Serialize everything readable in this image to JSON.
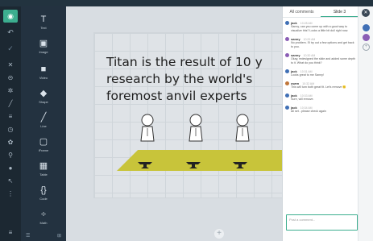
{
  "rail": {
    "items": [
      "visibility-icon",
      "undo-icon",
      "check-icon",
      "close-icon",
      "align-icon",
      "settings-icon",
      "brush-icon",
      "list-icon",
      "clock-icon",
      "color-icon",
      "pin-icon",
      "chat-icon",
      "pointer-icon",
      "more-icon",
      "menu-icon"
    ]
  },
  "tools": {
    "items": [
      {
        "label": "Text",
        "icon": "T"
      },
      {
        "label": "Image",
        "icon": "▣"
      },
      {
        "label": "Video",
        "icon": "■"
      },
      {
        "label": "Shape",
        "icon": "◆"
      },
      {
        "label": "Line",
        "icon": "╱"
      },
      {
        "label": "iFrame",
        "icon": "▢"
      },
      {
        "label": "Table",
        "icon": "▦"
      },
      {
        "label": "Code",
        "icon": "{}"
      },
      {
        "label": "Math",
        "icon": "÷"
      }
    ]
  },
  "slide": {
    "title": "Titan is the result of 10 y\nresearch by the world's\nforemost anvil experts"
  },
  "comments": {
    "tabs": [
      "All comments",
      "Slide 3"
    ],
    "thread": [
      {
        "user": "jack",
        "time": "10:28 AM",
        "text": "Sanny, can you come up with a good way to visualize this? Looks a little bit dull right now."
      },
      {
        "user": "sanny",
        "time": "10:29 AM",
        "text": "No problem. I'll try out a few options and get back to you."
      },
      {
        "user": "sanny",
        "time": "10:30 AM",
        "text": "Okay, redesigned the slide and added some depth to it. What do you think?"
      },
      {
        "user": "jack",
        "time": "10:31 AM",
        "text": "Looks great to me Sanny!"
      },
      {
        "user": "owen",
        "time": "10:32 AM",
        "text": "This will turn both great fit. Let's remove 🙂"
      },
      {
        "user": "jack",
        "time": "10:33 AM",
        "text": "Sure, will remove."
      },
      {
        "user": "jack",
        "time": "10:34 AM",
        "text": "All set - please check again"
      }
    ],
    "reply_placeholder": "Post a comment..."
  },
  "colors": {
    "accent": "#3cae8f",
    "stage": "#c8c43a",
    "sidebar": "#233240"
  }
}
